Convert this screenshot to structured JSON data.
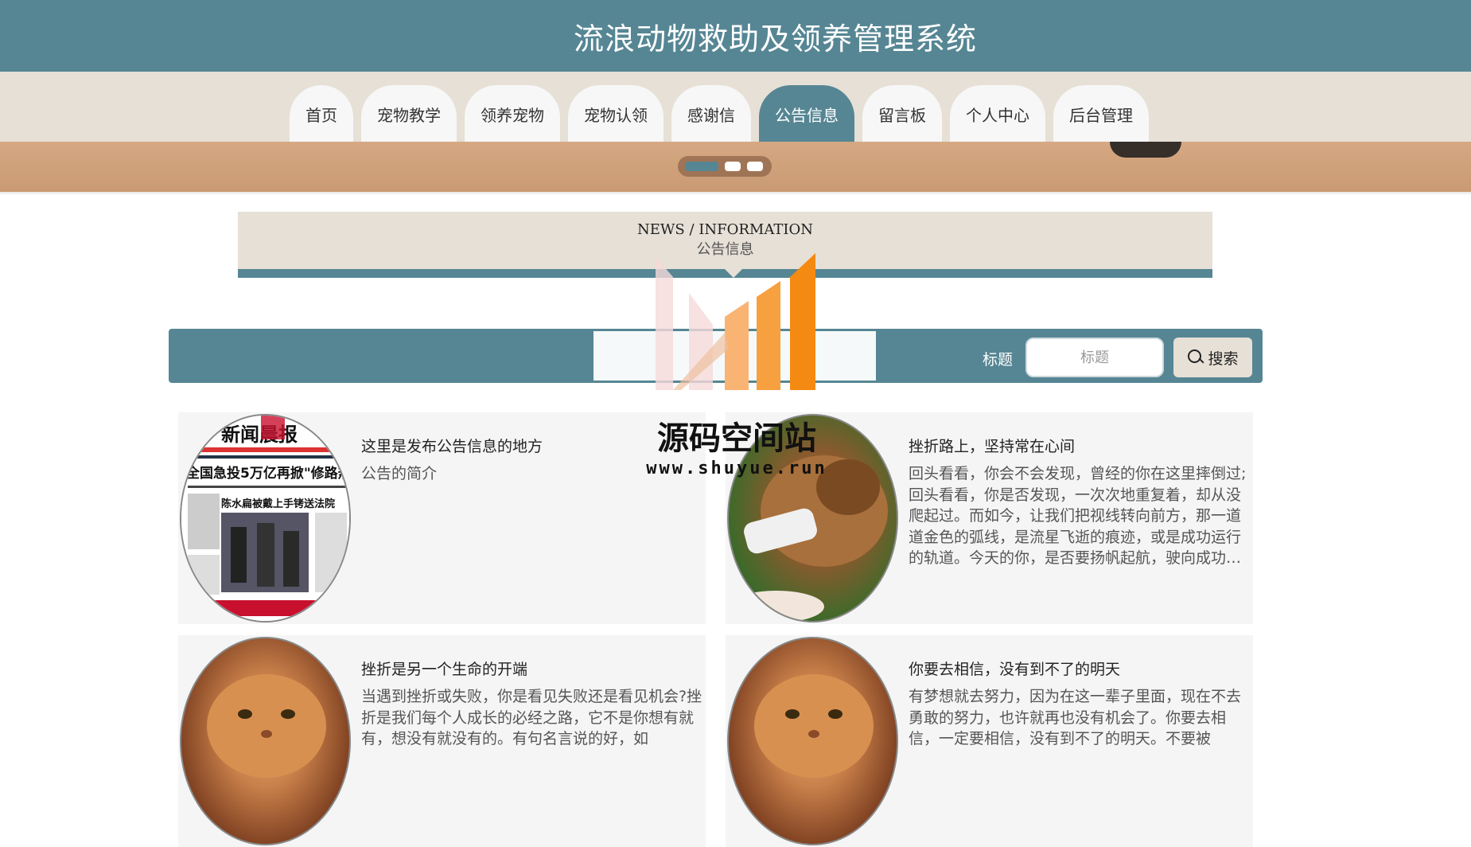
{
  "header": {
    "title": "流浪动物救助及领养管理系统"
  },
  "nav": {
    "items": [
      {
        "label": "首页",
        "active": false
      },
      {
        "label": "宠物教学",
        "active": false
      },
      {
        "label": "领养宠物",
        "active": false
      },
      {
        "label": "宠物认领",
        "active": false
      },
      {
        "label": "感谢信",
        "active": false
      },
      {
        "label": "公告信息",
        "active": true
      },
      {
        "label": "留言板",
        "active": false
      },
      {
        "label": "个人中心",
        "active": false
      },
      {
        "label": "后台管理",
        "active": false
      }
    ]
  },
  "carousel": {
    "slide_count": 3,
    "active_index": 0
  },
  "section": {
    "title_en": "NEWS / INFORMATION",
    "title_zh": "公告信息"
  },
  "search": {
    "label": "标题",
    "placeholder": "标题",
    "button_label": "搜索"
  },
  "notices": [
    {
      "title": "这里是发布公告信息的地方",
      "desc": "公告的简介",
      "image": "newspaper"
    },
    {
      "title": "挫折路上，坚持常在心间",
      "desc": "回头看看，你会不会发现，曾经的你在这里摔倒过;回头看看，你是否发现，一次次地重复着，却从没爬起过。而如今，让我们把视线转向前方，那一道道金色的弧线，是流星飞逝的痕迹，或是成功运行的轨道。今天的你，是否要扬帆起航，驶向成功的彼岸？",
      "image": "injured-dog"
    },
    {
      "title": "挫折是另一个生命的开端",
      "desc": "当遇到挫折或失败，你是看见失败还是看见机会?挫折是我们每个人成长的必经之路，它不是你想有就有，想没有就没有的。有句名言说的好，如",
      "image": "persian-cat"
    },
    {
      "title": "你要去相信，没有到不了的明天",
      "desc": "有梦想就去努力，因为在这一辈子里面，现在不去勇敢的努力，也许就再也没有机会了。你要去相信，一定要相信，没有到不了的明天。不要被",
      "image": "persian-cat"
    }
  ],
  "watermark": {
    "text": "源码空间站",
    "url": "www.shuyue.run"
  },
  "colors": {
    "primary": "#568694",
    "beige": "#e6e0d6",
    "card_bg": "#f5f5f5"
  }
}
